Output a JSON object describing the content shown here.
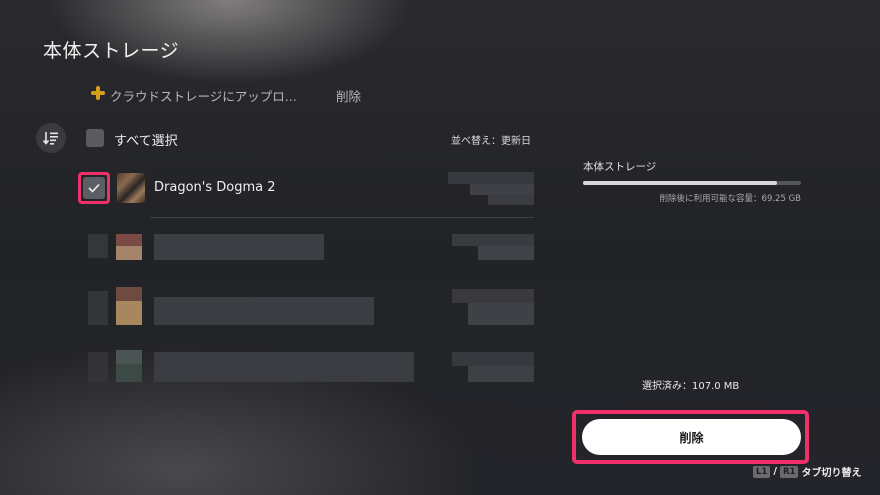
{
  "header": {
    "title": "本体ストレージ"
  },
  "toolbar": {
    "cloud_upload_label": "クラウドストレージにアップロ...",
    "delete_label": "削除"
  },
  "list": {
    "select_all_label": "すべて選択",
    "sort_label": "並べ替え：更新日",
    "items": [
      {
        "name": "Dragon's Dogma 2",
        "checked": true
      }
    ]
  },
  "storage": {
    "label": "本体ストレージ",
    "used_fraction": 0.89,
    "free_text": "削除後に利用可能な容量：69.25 GB"
  },
  "footer": {
    "selected_text": "選択済み：107.0 MB",
    "delete_button_label": "削除",
    "hint_key_l1": "L1",
    "hint_separator": "/",
    "hint_key_r1": "R1",
    "hint_text": "タブ切り替え"
  },
  "colors": {
    "highlight": "#f0306a",
    "plus_icon": "#d4a017",
    "button_bg": "#ffffff"
  }
}
